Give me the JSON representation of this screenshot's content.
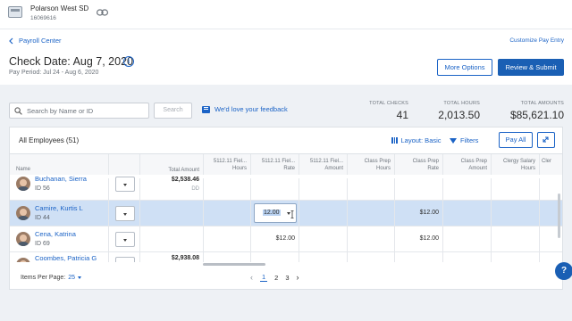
{
  "org": {
    "name": "Polarson West SD",
    "id": "16069616"
  },
  "nav": {
    "back_label": "Payroll Center",
    "customize_label": "Customize Pay Entry"
  },
  "header": {
    "check_date": "Check Date: Aug 7, 2020",
    "pay_period": "Pay Period:  Jul 24 - Aug 6, 2020",
    "more_options": "More Options",
    "review_submit": "Review & Submit"
  },
  "toolbar": {
    "search_placeholder": "Search by Name or ID",
    "search_button": "Search",
    "feedback": "We'd love your feedback"
  },
  "totals": [
    {
      "label": "TOTAL CHECKS",
      "value": "41"
    },
    {
      "label": "TOTAL HOURS",
      "value": "2,013.50"
    },
    {
      "label": "TOTAL AMOUNTS",
      "value": "$85,621.10"
    }
  ],
  "card": {
    "title": "All Employees (51)",
    "layout_label": "Layout: Basic",
    "filters_label": "Filters",
    "pay_all": "Pay All"
  },
  "columns": {
    "name": "Name",
    "total_amount": "Total Amount",
    "c1": [
      "5112.11 Fiel...",
      "Hours"
    ],
    "c2": [
      "5112.11 Fiel...",
      "Rate"
    ],
    "c3": [
      "5112.11 Fiel...",
      "Amount"
    ],
    "c4": [
      "Class Prep",
      "Hours"
    ],
    "c5": [
      "Class Prep",
      "Rate"
    ],
    "c6": [
      "Class Prep",
      "Amount"
    ],
    "c7": [
      "Clergy Salary",
      "Hours"
    ],
    "c8": [
      "Cler"
    ]
  },
  "rows": [
    {
      "name": "Buchanan, Sierra",
      "id": "ID 56",
      "total": "$2,538.46",
      "total_sub": "DD",
      "rate": "",
      "cp_rate": ""
    },
    {
      "name": "Camire, Kurtis L",
      "id": "ID 44",
      "total": "",
      "total_sub": "",
      "rate": "12.00",
      "cp_rate": "$12.00"
    },
    {
      "name": "Cena, Katrina",
      "id": "ID 69",
      "total": "",
      "total_sub": "",
      "rate": "$12.00",
      "cp_rate": "$12.00"
    },
    {
      "name": "Coombes, Patricia G",
      "id": "",
      "total": "$2,938.08",
      "total_sub": "",
      "rate": "",
      "cp_rate": ""
    }
  ],
  "footer": {
    "items_per_page_label": "Items Per Page:",
    "items_per_page_value": "25",
    "pages": [
      "1",
      "2",
      "3"
    ]
  },
  "help_label": "?"
}
